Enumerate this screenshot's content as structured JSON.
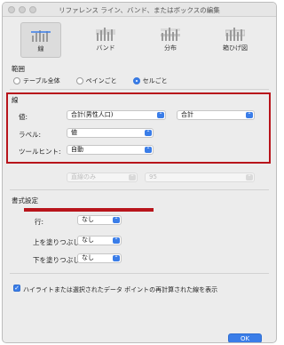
{
  "window": {
    "title": "リファレンス ライン、バンド、またはボックスの編集"
  },
  "toolbar": {
    "items": [
      {
        "label": "線",
        "icon": "line-chart-icon"
      },
      {
        "label": "バンド",
        "icon": "band-chart-icon"
      },
      {
        "label": "分布",
        "icon": "distribution-chart-icon"
      },
      {
        "label": "箱ひげ図",
        "icon": "box-plot-icon"
      }
    ],
    "selected": "線"
  },
  "scope": {
    "heading": "範囲",
    "options": [
      "テーブル全体",
      "ペインごと",
      "セルごと"
    ],
    "selected": "セルごと"
  },
  "line": {
    "heading": "線",
    "value_label": "値:",
    "value_field": "合計(男性人口)",
    "value_aggregation": "合計",
    "label_label": "ラベル:",
    "label_value": "値",
    "tooltip_label": "ツールヒント:",
    "tooltip_value": "自動"
  },
  "confidence": {
    "mode": "直線のみ",
    "percent": "95"
  },
  "format": {
    "heading": "書式設定",
    "row_label": "行:",
    "row_value": "なし",
    "fill_above_label": "上を塗りつぶし:",
    "fill_above_value": "なし",
    "fill_below_label": "下を塗りつぶし:",
    "fill_below_value": "なし"
  },
  "recalc_checkbox": {
    "label": "ハイライトまたは選択されたデータ ポイントの再計算された線を表示",
    "checked": true
  },
  "ok_label": "OK",
  "colors": {
    "accent": "#3a7de8",
    "highlight_box": "#b8141b"
  }
}
